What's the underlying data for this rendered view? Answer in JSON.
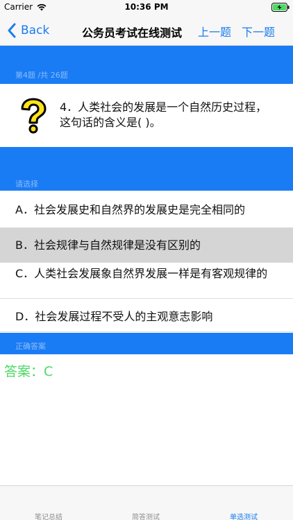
{
  "status_bar": {
    "carrier": "Carrier",
    "time": "10:36 PM",
    "wifi_icon": "wifi-icon",
    "battery_icon": "battery-charging-icon"
  },
  "nav": {
    "back_label": "Back",
    "title": "公务员考试在线测试",
    "prev_label": "上一题",
    "next_label": "下一题"
  },
  "bands": {
    "progress": "第4题 /共 26题",
    "section": "请选择",
    "answer_header": "正确答案"
  },
  "question": {
    "icon": "question-mark-icon",
    "text": "4．人类社会的发展是一个自然历史过程，这句话的含义是( )。"
  },
  "options": [
    {
      "label": "A．社会发展史和自然界的发展史是完全相同的",
      "selected": false
    },
    {
      "label": "B．社会规律与自然规律是没有区别的",
      "selected": true
    },
    {
      "label": "C．人类社会发展象自然界发展一样是有客观规律的",
      "selected": false
    },
    {
      "label": "D．社会发展过程不受人的主观意志影响",
      "selected": false
    }
  ],
  "answer": "答案：C",
  "tabs": [
    {
      "label": "笔记总结",
      "active": false
    },
    {
      "label": "简答测试",
      "active": false
    },
    {
      "label": "单选测试",
      "active": true
    }
  ],
  "colors": {
    "accent": "#1a7cf0",
    "band": "#1a7cf5",
    "answer": "#4cd964",
    "selected_option": "#d5d5d5"
  }
}
